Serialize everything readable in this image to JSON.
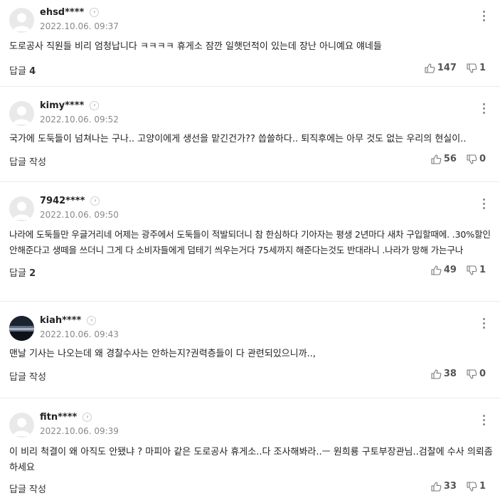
{
  "comments": [
    {
      "nickname": "ehsd****",
      "date": "2022.10.06. 09:37",
      "text": "도로공사 직원들 비리 엄청납니다 ㅋㅋㅋㅋ 휴게소 잠깐 일햇던적이 있는데 장난 아니예요 얘네들",
      "reply_label": "답글",
      "reply_count": "4",
      "likes": "147",
      "dislikes": "1"
    },
    {
      "nickname": "kimy****",
      "date": "2022.10.06. 09:52",
      "text": "국가에 도둑들이 넘쳐나는 구나.. 고양이에게 생선을 맡긴건가?? 씁쓸하다.. 퇴직후에는 아무 것도 없는 우리의 현실이..",
      "reply_label": "답글 작성",
      "reply_count": "",
      "likes": "56",
      "dislikes": "0"
    },
    {
      "nickname": "7942****",
      "date": "2022.10.06. 09:50",
      "text": "나라에 도둑들만 우글거리네 어제는 광주에서 도둑들이 적발되더니 참 한심하다 기아자는 평생 2년마다 새차 구입할때에. .30%할인 안해준다고 생떼을 쓰더니 그게 다 소비자들에게 덤테기 씌우는거다 75세까지 해준다는것도 반대라니 .나라가 망해 가는구나",
      "reply_label": "답글",
      "reply_count": "2",
      "likes": "49",
      "dislikes": "1"
    },
    {
      "nickname": "kiah****",
      "date": "2022.10.06. 09:43",
      "text": "맨날 기사는 나오는데 왜 경찰수사는 안하는지?권력층들이 다 관련되있으니까..,",
      "reply_label": "답글 작성",
      "reply_count": "",
      "likes": "38",
      "dislikes": "0"
    },
    {
      "nickname": "fitn****",
      "date": "2022.10.06. 09:39",
      "text": "이 비리 척결이 왜 아직도 안됐냐 ? 마피아 같은 도로공사 휴게소..다 조사해봐라..ㅡ 원희룡 구토부장관님..검찰에 수사 의뢰좀 하세요",
      "reply_label": "답글 작성",
      "reply_count": "",
      "likes": "33",
      "dislikes": "1"
    }
  ],
  "icons": {
    "avatar_default": "default-profile-icon",
    "avatar_photo": "night-sky-photo",
    "like": "thumbs-up-icon",
    "dislike": "thumbs-down-icon",
    "more": "more-vertical-icon",
    "profile_link": "chevron-right-icon"
  },
  "colors": {
    "text": "#222222",
    "meta": "#888888",
    "divider": "#ebebeb",
    "avatar_bg": "#e9e9e9"
  }
}
